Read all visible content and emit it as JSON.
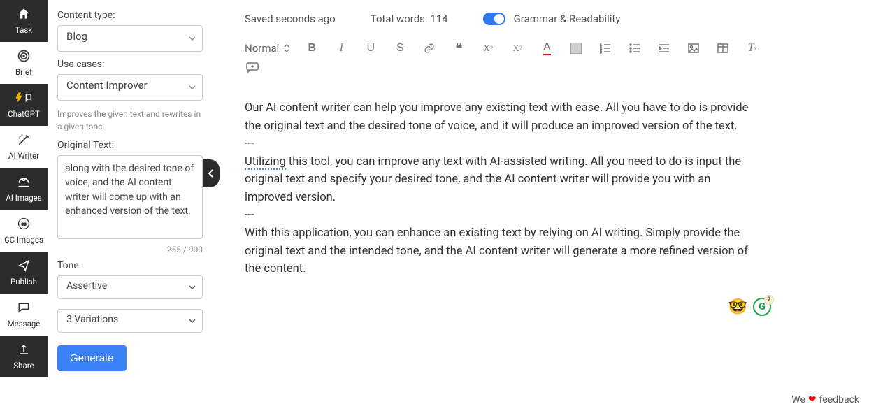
{
  "nav": {
    "task": "Task",
    "brief": "Brief",
    "chatgpt": "ChatGPT",
    "ai_writer": "AI Writer",
    "ai_images": "AI Images",
    "cc_images": "CC Images",
    "publish": "Publish",
    "message": "Message",
    "share": "Share"
  },
  "sidebar": {
    "content_type_label": "Content type:",
    "content_type_value": "Blog",
    "use_cases_label": "Use cases:",
    "use_cases_value": "Content Improver",
    "use_cases_hint": "Improves the given text and rewrites in a given tone.",
    "original_text_label": "Original Text:",
    "original_text_value": "along with the desired tone of voice, and the AI content writer will come up with an enhanced version of the text.",
    "char_count": "255 / 900",
    "tone_label": "Tone:",
    "tone_value": "Assertive",
    "variations_value": "3 Variations",
    "generate_label": "Generate"
  },
  "topbar": {
    "saved": "Saved seconds ago",
    "total_words": "Total words: 114",
    "grammar_label": "Grammar & Readability"
  },
  "toolbar": {
    "format_value": "Normal"
  },
  "editor": {
    "p1": "Our AI content writer can help you improve any existing text with ease. All you have to do is provide the original text and the desired tone of voice, and it will produce an improved version of the text.",
    "sep1": "---",
    "p2_word": "Utilizing",
    "p2_rest": " this tool, you can improve any text with AI-assisted writing. All you need to do is input the original text and specify your desired tone, and the AI content writer will provide you with an improved version.",
    "sep2": "---",
    "p3": "With this application, you can enhance an existing text by relying on AI writing. Simply provide the original text and the intended tone, and the AI content writer will generate a more refined version of the content."
  },
  "badges": {
    "g_count": "2"
  },
  "footer": {
    "prefix": "We ",
    "suffix": " feedback"
  }
}
